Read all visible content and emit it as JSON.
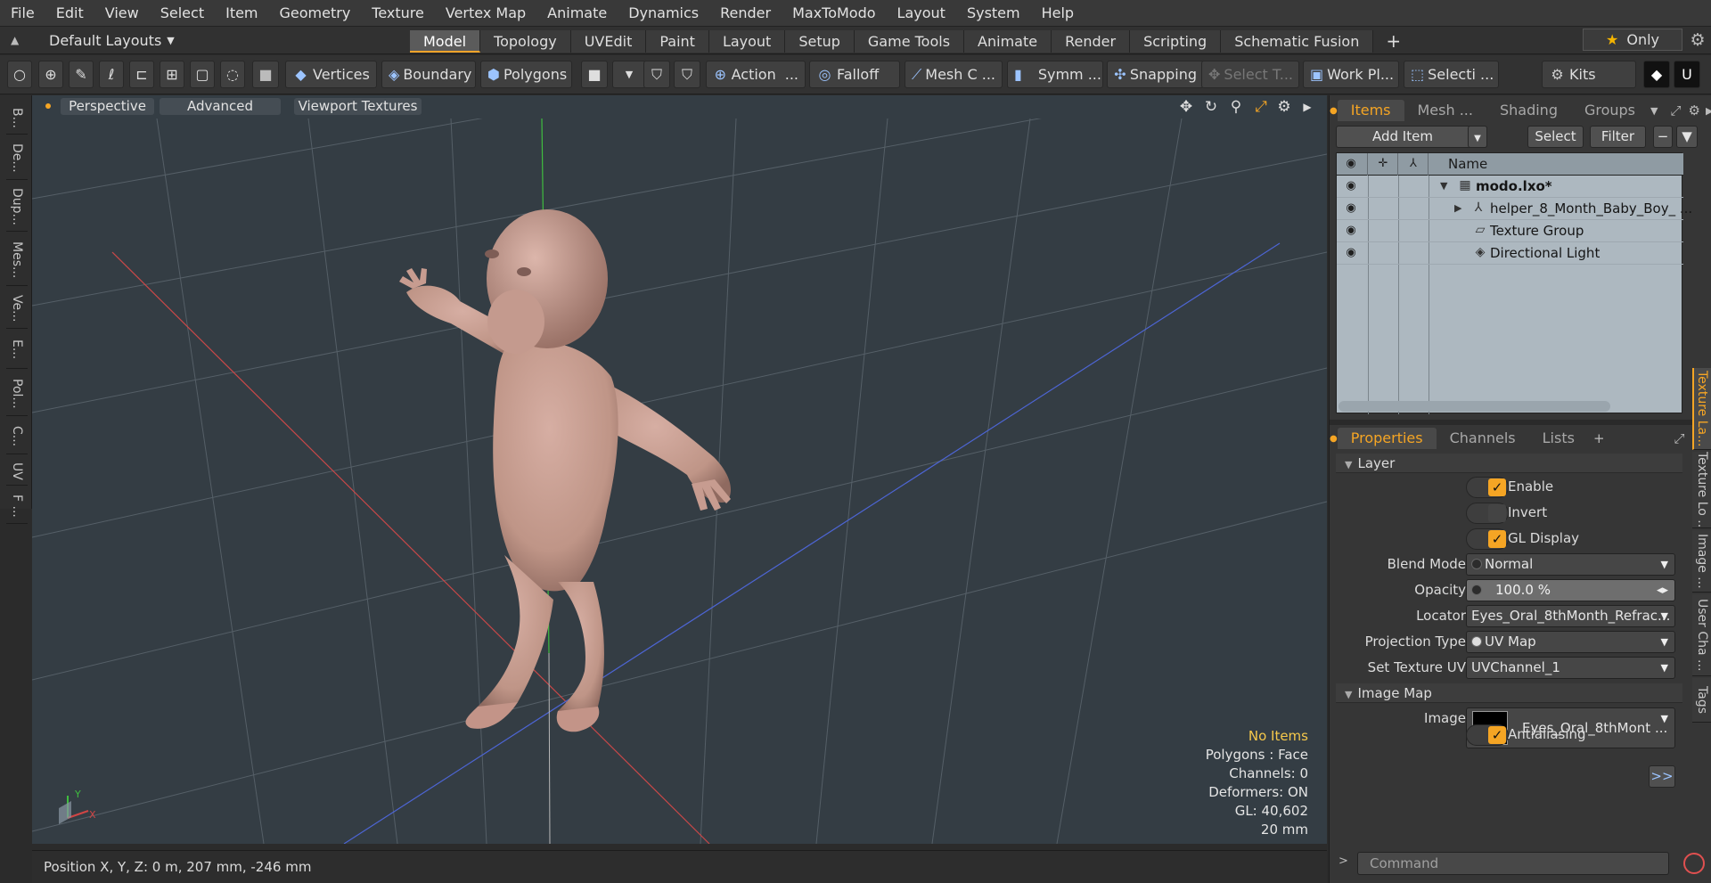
{
  "menu": [
    "File",
    "Edit",
    "View",
    "Select",
    "Item",
    "Geometry",
    "Texture",
    "Vertex Map",
    "Animate",
    "Dynamics",
    "Render",
    "MaxToModo",
    "Layout",
    "System",
    "Help"
  ],
  "layout": {
    "name": "Default Layouts",
    "tabs": [
      "Model",
      "Topology",
      "UVEdit",
      "Paint",
      "Layout",
      "Setup",
      "Game Tools",
      "Animate",
      "Render",
      "Scripting",
      "Schematic Fusion"
    ],
    "active_tab": "Model",
    "only_label": "Only"
  },
  "toolbar": {
    "vertices": "Vertices",
    "boundary": "Boundary",
    "polygons": "Polygons",
    "action": "Action",
    "action_more": "...",
    "falloff": "Falloff",
    "mesh": "Mesh C ...",
    "symm": "Symm ...",
    "snapping": "Snapping",
    "select_t": "Select T...",
    "work_plane": "Work Pl...",
    "selection": "Selecti ...",
    "kits": "Kits"
  },
  "left_tabs": [
    "B...",
    "De...",
    "Dup...",
    "Mes...",
    "Ve...",
    "E...",
    "Pol...",
    "C...",
    "UV",
    "F ..."
  ],
  "viewport": {
    "perspective": "Perspective",
    "advanced": "Advanced",
    "textures": "Viewport Textures",
    "axis_x": "X",
    "axis_y": "Y",
    "info": {
      "no_items": "No Items",
      "polygons": "Polygons : Face",
      "channels": "Channels: 0",
      "deformers": "Deformers: ON",
      "gl": "GL: 40,602",
      "scale": "20 mm"
    }
  },
  "status": {
    "position": "Position X, Y, Z:  0 m, 207 mm, -246 mm"
  },
  "items_panel": {
    "tabs": [
      "Items",
      "Mesh ...",
      "Shading",
      "Groups"
    ],
    "active": "Items",
    "add_item": "Add Item",
    "select": "Select",
    "filter": "Filter",
    "col_name": "Name",
    "rows": [
      {
        "name": "modo.lxo*"
      },
      {
        "name": "helper_8_Month_Baby_Boy_ ..."
      },
      {
        "name": "Texture Group"
      },
      {
        "name": "Directional Light"
      }
    ]
  },
  "properties": {
    "tabs": [
      "Properties",
      "Channels",
      "Lists"
    ],
    "active": "Properties",
    "layer_section": "Layer",
    "enable": "Enable",
    "invert": "Invert",
    "gl_display": "GL Display",
    "blend_mode_label": "Blend Mode",
    "blend_mode": "Normal",
    "opacity_label": "Opacity",
    "opacity": "100.0 %",
    "locator_label": "Locator",
    "locator": "Eyes_Oral_8thMonth_Refrac...",
    "projection_label": "Projection Type",
    "projection": "UV Map",
    "set_uv_label": "Set Texture UV",
    "set_uv": "UVChannel_1",
    "image_map_section": "Image Map",
    "image_label": "Image",
    "image": "Eyes_Oral_8thMont ...",
    "antialiasing": "Antialiasing",
    "more": ">>",
    "command_placeholder": "Command"
  },
  "side_tabs": [
    "Texture La...",
    "Texture Lo ...",
    "Image ...",
    "User Cha ...",
    "Tags"
  ],
  "colors": {
    "accent": "#f5a524",
    "viewport_bg": "#343d44",
    "x_axis": "#d04545",
    "z_axis": "#4a64d8",
    "y_axis": "#3fc13f"
  }
}
